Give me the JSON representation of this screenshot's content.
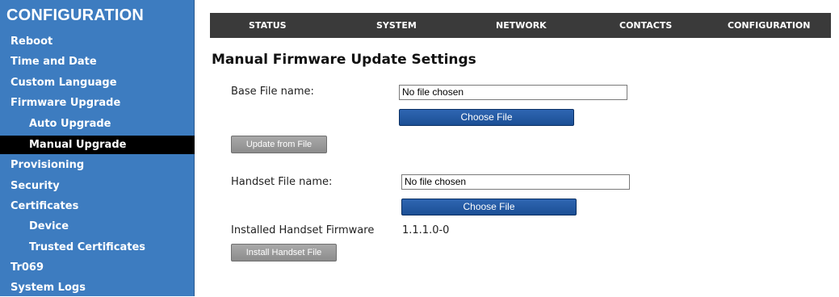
{
  "sidebar": {
    "title": "CONFIGURATION",
    "items": [
      {
        "label": "Reboot"
      },
      {
        "label": "Time and Date"
      },
      {
        "label": "Custom Language"
      },
      {
        "label": "Firmware Upgrade"
      },
      {
        "label": "Auto Upgrade"
      },
      {
        "label": "Manual Upgrade",
        "active": true
      },
      {
        "label": "Provisioning"
      },
      {
        "label": "Security"
      },
      {
        "label": "Certificates"
      },
      {
        "label": "Device"
      },
      {
        "label": "Trusted Certificates"
      },
      {
        "label": "Tr069"
      },
      {
        "label": "System Logs"
      }
    ]
  },
  "nav": {
    "items": [
      {
        "label": "STATUS"
      },
      {
        "label": "SYSTEM"
      },
      {
        "label": "NETWORK"
      },
      {
        "label": "CONTACTS"
      },
      {
        "label": "CONFIGURATION"
      }
    ]
  },
  "main": {
    "title": "Manual Firmware Update Settings",
    "base": {
      "label": "Base File name:",
      "file_value": "No file chosen",
      "choose_label": "Choose File",
      "update_label": "Update from File"
    },
    "handset": {
      "label": "Handset File name:",
      "file_value": "No file chosen",
      "choose_label": "Choose File",
      "installed_label": "Installed Handset Firmware",
      "installed_value": "1.1.1.0-0",
      "install_label": "Install Handset File"
    }
  },
  "colors": {
    "sidebar_bg": "#3d7cc0",
    "active_item_bg": "#000000",
    "nav_bg": "#3a3a3a",
    "choose_button": "#2559a3",
    "gray_button": "#999999"
  }
}
